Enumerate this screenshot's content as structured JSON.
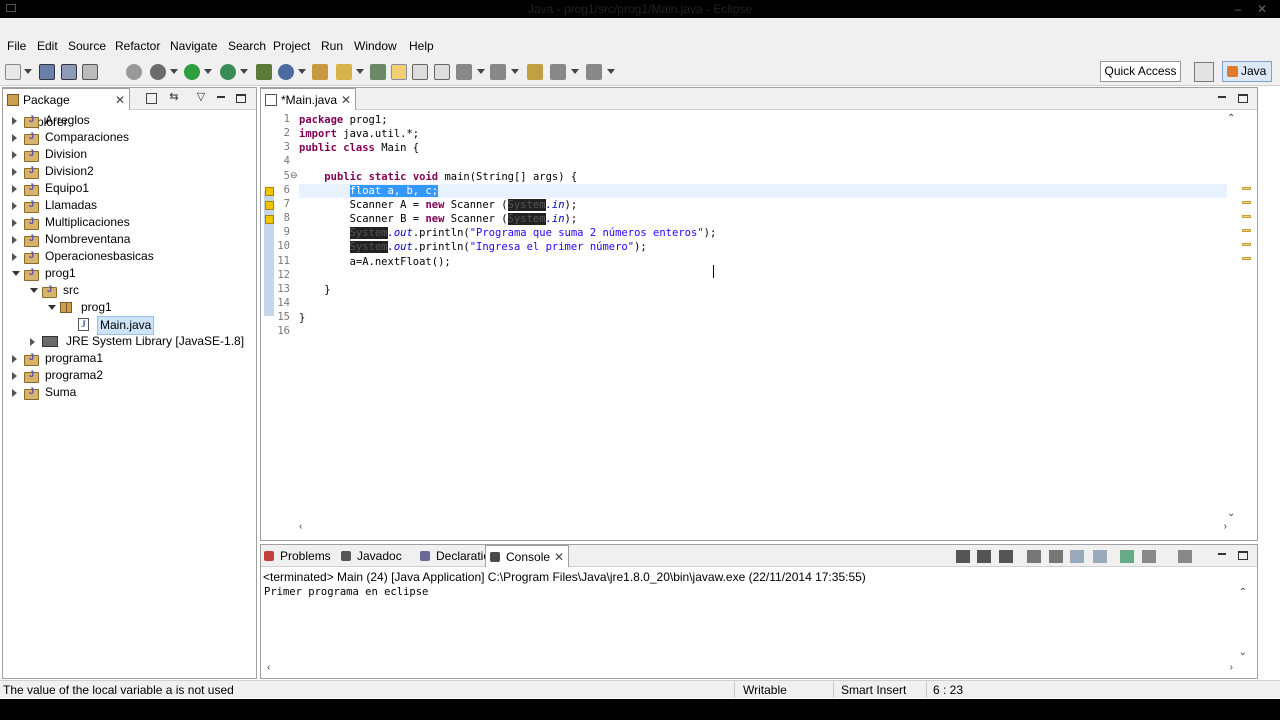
{
  "window": {
    "title": "Java - prog1/src/prog1/Main.java - Eclipse"
  },
  "menu": [
    "File",
    "Edit",
    "Source",
    "Refactor",
    "Navigate",
    "Search",
    "Project",
    "Run",
    "Window",
    "Help"
  ],
  "toolbar": {
    "quick_access": "Quick Access",
    "perspective": "Java"
  },
  "package_explorer": {
    "title": "Package Explorer",
    "items": [
      {
        "label": "Arreglos",
        "level": 0,
        "expanded": false,
        "type": "project"
      },
      {
        "label": "Comparaciones",
        "level": 0,
        "expanded": false,
        "type": "project"
      },
      {
        "label": "Division",
        "level": 0,
        "expanded": false,
        "type": "project"
      },
      {
        "label": "Division2",
        "level": 0,
        "expanded": false,
        "type": "project"
      },
      {
        "label": "Equipo1",
        "level": 0,
        "expanded": false,
        "type": "project"
      },
      {
        "label": "Llamadas",
        "level": 0,
        "expanded": false,
        "type": "project"
      },
      {
        "label": "Multiplicaciones",
        "level": 0,
        "expanded": false,
        "type": "project"
      },
      {
        "label": "Nombreventana",
        "level": 0,
        "expanded": false,
        "type": "project"
      },
      {
        "label": "Operacionesbasicas",
        "level": 0,
        "expanded": false,
        "type": "project"
      },
      {
        "label": "prog1",
        "level": 0,
        "expanded": true,
        "type": "project"
      },
      {
        "label": "src",
        "level": 1,
        "expanded": true,
        "type": "src"
      },
      {
        "label": "prog1",
        "level": 2,
        "expanded": true,
        "type": "package"
      },
      {
        "label": "Main.java",
        "level": 3,
        "expanded": false,
        "type": "file",
        "selected": true
      },
      {
        "label": "JRE System Library [JavaSE-1.8]",
        "level": 1,
        "expanded": false,
        "type": "library"
      },
      {
        "label": "programa1",
        "level": 0,
        "expanded": false,
        "type": "project"
      },
      {
        "label": "programa2",
        "level": 0,
        "expanded": false,
        "type": "project"
      },
      {
        "label": "Suma",
        "level": 0,
        "expanded": false,
        "type": "project"
      }
    ]
  },
  "editor": {
    "tab_label": "*Main.java",
    "line_numbers": [
      "1",
      "2",
      "3",
      "4",
      "5",
      "6",
      "7",
      "8",
      "9",
      "10",
      "11",
      "12",
      "13",
      "14",
      "15",
      "16"
    ],
    "fold_marker": "⊖",
    "lines": [
      [
        {
          "t": "package",
          "c": "kw"
        },
        {
          "t": " prog1;"
        }
      ],
      [
        {
          "t": "import",
          "c": "kw"
        },
        {
          "t": " java.util.*;"
        }
      ],
      [
        {
          "t": "public",
          "c": "kw"
        },
        {
          "t": " "
        },
        {
          "t": "class",
          "c": "kw"
        },
        {
          "t": " Main {"
        }
      ],
      [],
      [
        {
          "t": "    "
        },
        {
          "t": "public",
          "c": "kw"
        },
        {
          "t": " "
        },
        {
          "t": "static",
          "c": "kw"
        },
        {
          "t": " "
        },
        {
          "t": "void",
          "c": "kw"
        },
        {
          "t": " main(String[] args) {"
        }
      ],
      [
        {
          "t": "        "
        },
        {
          "t": "float a, b, c;",
          "c": "sel"
        }
      ],
      [
        {
          "t": "        Scanner A = "
        },
        {
          "t": "new",
          "c": "kw"
        },
        {
          "t": " Scanner ("
        },
        {
          "t": "System",
          "c": "redacted"
        },
        {
          "t": ".in",
          "c": "fld"
        },
        {
          "t": ");"
        }
      ],
      [
        {
          "t": "        Scanner B = "
        },
        {
          "t": "new",
          "c": "kw"
        },
        {
          "t": " Scanner ("
        },
        {
          "t": "System",
          "c": "redacted"
        },
        {
          "t": ".in",
          "c": "fld"
        },
        {
          "t": ");"
        }
      ],
      [
        {
          "t": "        "
        },
        {
          "t": "System",
          "c": "redacted"
        },
        {
          "t": ".out",
          "c": "fld"
        },
        {
          "t": ".println("
        },
        {
          "t": "\"Programa que suma 2 números enteros\"",
          "c": "str"
        },
        {
          "t": ");"
        }
      ],
      [
        {
          "t": "        "
        },
        {
          "t": "System",
          "c": "redacted"
        },
        {
          "t": ".out",
          "c": "fld"
        },
        {
          "t": ".println("
        },
        {
          "t": "\"Ingresa el primer número\"",
          "c": "str"
        },
        {
          "t": ");"
        }
      ],
      [
        {
          "t": "        a=A.nextFloat();"
        }
      ],
      [],
      [
        {
          "t": "    }"
        }
      ],
      [],
      [
        {
          "t": "}"
        }
      ],
      []
    ]
  },
  "bottom_panel": {
    "tabs": [
      {
        "label": "Problems",
        "active": false
      },
      {
        "label": "Javadoc",
        "active": false
      },
      {
        "label": "Declaration",
        "active": false
      },
      {
        "label": "Console",
        "active": true
      }
    ],
    "console_header": "<terminated> Main (24) [Java Application] C:\\Program Files\\Java\\jre1.8.0_20\\bin\\javaw.exe (22/11/2014 17:35:55)",
    "console_output": "Primer programa en eclipse"
  },
  "status": {
    "message": "The value of the local variable a is not used",
    "writable": "Writable",
    "insert_mode": "Smart Insert",
    "position": "6 : 23"
  },
  "colors": {
    "keyword": "#7f0055",
    "string": "#2a00ff",
    "field": "#0000c0",
    "selection": "#3399ff",
    "line_number": "#787878"
  }
}
